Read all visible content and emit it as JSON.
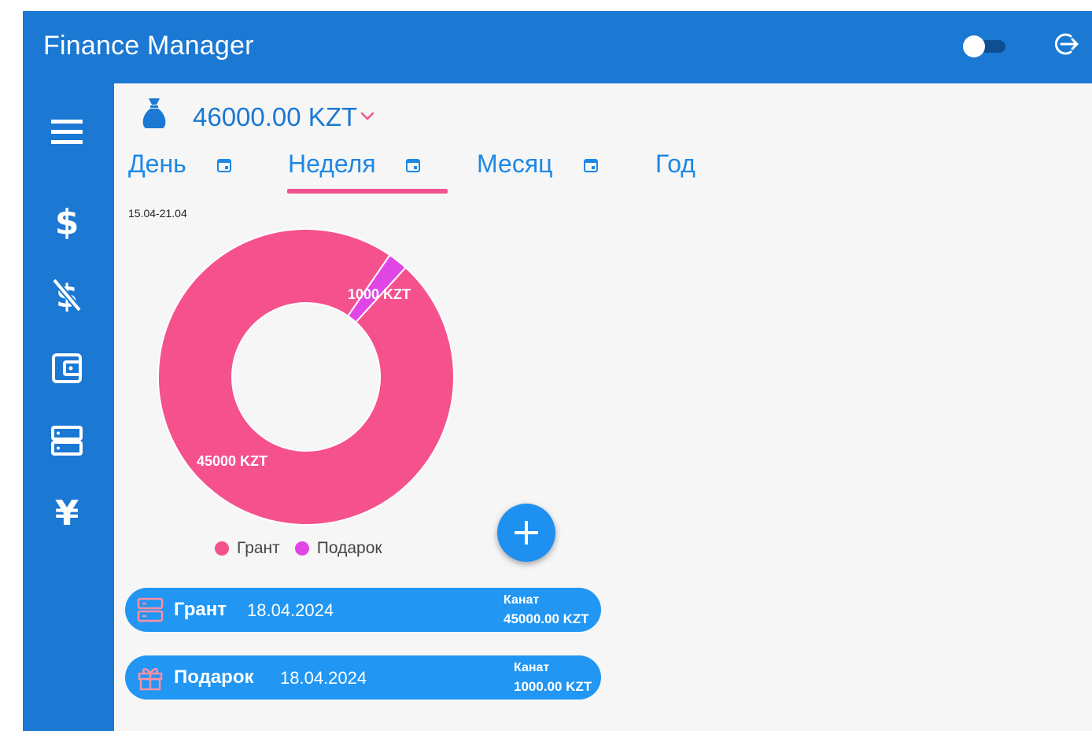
{
  "header": {
    "title": "Finance Manager",
    "theme_toggle_on": false
  },
  "sidebar": {
    "items": [
      {
        "icon": "menu-icon"
      },
      {
        "icon": "dollar-icon"
      },
      {
        "icon": "no-dollar-icon"
      },
      {
        "icon": "wallet-icon"
      },
      {
        "icon": "storage-icon"
      },
      {
        "icon": "yen-icon"
      }
    ]
  },
  "balance": {
    "icon": "money-bag-icon",
    "value": "46000.00 KZT"
  },
  "tabs": [
    {
      "label": "День",
      "icon": "calendar-icon"
    },
    {
      "label": "Неделя",
      "icon": "calendar-icon",
      "active": true
    },
    {
      "label": "Месяц",
      "icon": "calendar-icon"
    },
    {
      "label": "Год"
    }
  ],
  "period": "15.04-21.04",
  "chart_data": {
    "type": "pie",
    "donut": true,
    "categories": [
      "Грант",
      "Подарок"
    ],
    "values": [
      45000,
      1000
    ],
    "labels": [
      "45000 KZT",
      "1000 KZT"
    ],
    "colors": [
      "#f5518d",
      "#e046e6"
    ],
    "legend": "bottom"
  },
  "transactions": [
    {
      "icon": "storage-icon",
      "name": "Грант",
      "date": "18.04.2024",
      "user": "Канат",
      "amount": "45000.00 KZT"
    },
    {
      "icon": "gift-icon",
      "name": "Подарок",
      "date": "18.04.2024",
      "user": "Канат",
      "amount": "1000.00 KZT"
    }
  ],
  "colors": {
    "primary": "#1b78d3",
    "accent": "#f25390",
    "card": "#2196f3"
  }
}
